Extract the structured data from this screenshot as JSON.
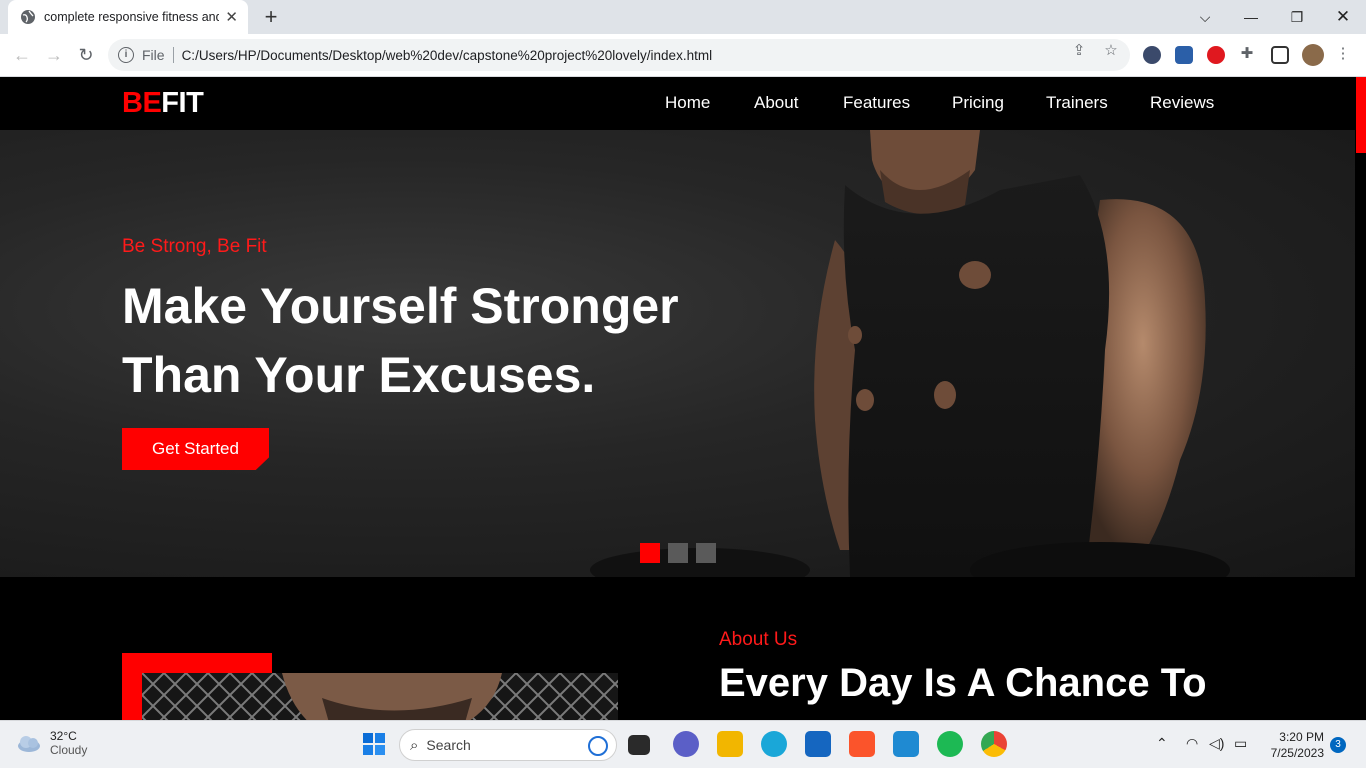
{
  "browser": {
    "tab_title": "complete responsive fitness and",
    "address_scheme": "File",
    "address_url": "C:/Users/HP/Documents/Desktop/web%20dev/capstone%20project%20lovely/index.html"
  },
  "site": {
    "logo_red": "BE",
    "logo_white": "FIT",
    "nav": [
      "Home",
      "About",
      "Features",
      "Pricing",
      "Trainers",
      "Reviews"
    ],
    "hero": {
      "tagline": "Be Strong, Be Fit",
      "headline_line1": "Make Yourself Stronger",
      "headline_line2": "Than Your Excuses.",
      "cta": "Get Started",
      "slide_count": 3,
      "active_slide": 1
    },
    "about": {
      "label": "About Us",
      "heading": "Every Day Is A Chance To"
    },
    "colors": {
      "accent": "#ff0000",
      "background": "#000000"
    }
  },
  "taskbar": {
    "weather_temp": "32°C",
    "weather_cond": "Cloudy",
    "search_label": "Search",
    "time": "3:20 PM",
    "date": "7/25/2023",
    "notifications": "3"
  }
}
